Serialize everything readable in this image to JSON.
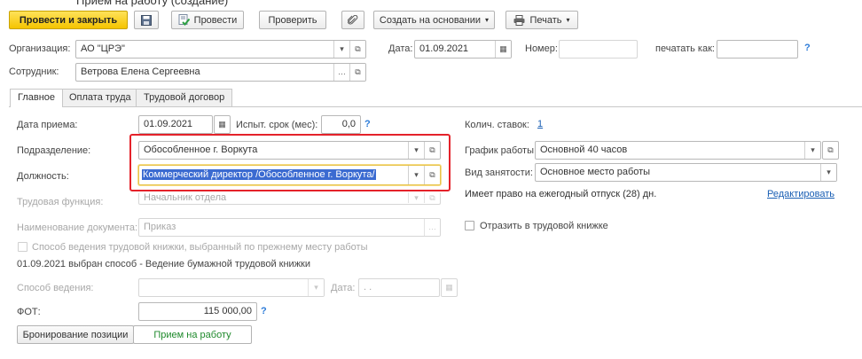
{
  "window": {
    "title_partial": "Прием на работу (создание)"
  },
  "toolbar": {
    "post_and_close": "Провести и закрыть",
    "post": "Провести",
    "check": "Проверить",
    "create_based_on": "Создать на основании",
    "print": "Печать",
    "help": "?"
  },
  "header": {
    "organization_label": "Организация:",
    "organization_value": "АО \"ЦРЭ\"",
    "date_label": "Дата:",
    "date_value": "01.09.2021",
    "number_label": "Номер:",
    "number_value": "",
    "print_as_label": "печатать как:",
    "print_as_value": "",
    "employee_label": "Сотрудник:",
    "employee_value": "Ветрова Елена Сергеевна"
  },
  "tabs": [
    "Главное",
    "Оплата труда",
    "Трудовой договор"
  ],
  "main": {
    "hire_date_label": "Дата приема:",
    "hire_date_value": "01.09.2021",
    "probation_label": "Испыт. срок (мес):",
    "probation_value": "0,0",
    "rates_label": "Колич. ставок:",
    "rates_value": "1",
    "department_label": "Подразделение:",
    "department_value": "Обособленное г. Воркута",
    "schedule_label": "График работы:",
    "schedule_value": "Основной 40 часов",
    "position_label": "Должность:",
    "position_value": "Коммерческий директор /Обособленное г. Воркута/",
    "employment_type_label": "Вид занятости:",
    "employment_type_value": "Основное место работы",
    "vacation_note": "Имеет право на ежегодный отпуск (28) дн.",
    "edit_link": "Редактировать",
    "labor_function_label": "Трудовая функция:",
    "labor_function_value": "Начальник отдела",
    "doc_name_label": "Наименование документа:",
    "doc_name_value": "Приказ",
    "reflect_in_book_label": "Отразить в трудовой книжке",
    "book_method_checkbox_label": "Способ ведения трудовой книжки, выбранный по прежнему месту работы",
    "book_method_note": "01.09.2021 выбран способ - Ведение бумажной трудовой книжки",
    "method_label": "Способ ведения:",
    "method_value": "",
    "method_date_label": "Дата:",
    "method_date_value": " .  .",
    "fot_label": "ФОТ:",
    "fot_value": "115 000,00",
    "reserve_position": "Бронирование позиции",
    "hire_tab_label": "Прием на работу"
  },
  "colors": {
    "primary_button": "#f5c400",
    "highlight_frame": "#e4222a",
    "link": "#1a5fb4",
    "help_icon": "#2b7bd8",
    "selection": "#3b6bd1",
    "green_text": "#1f8a2c"
  }
}
